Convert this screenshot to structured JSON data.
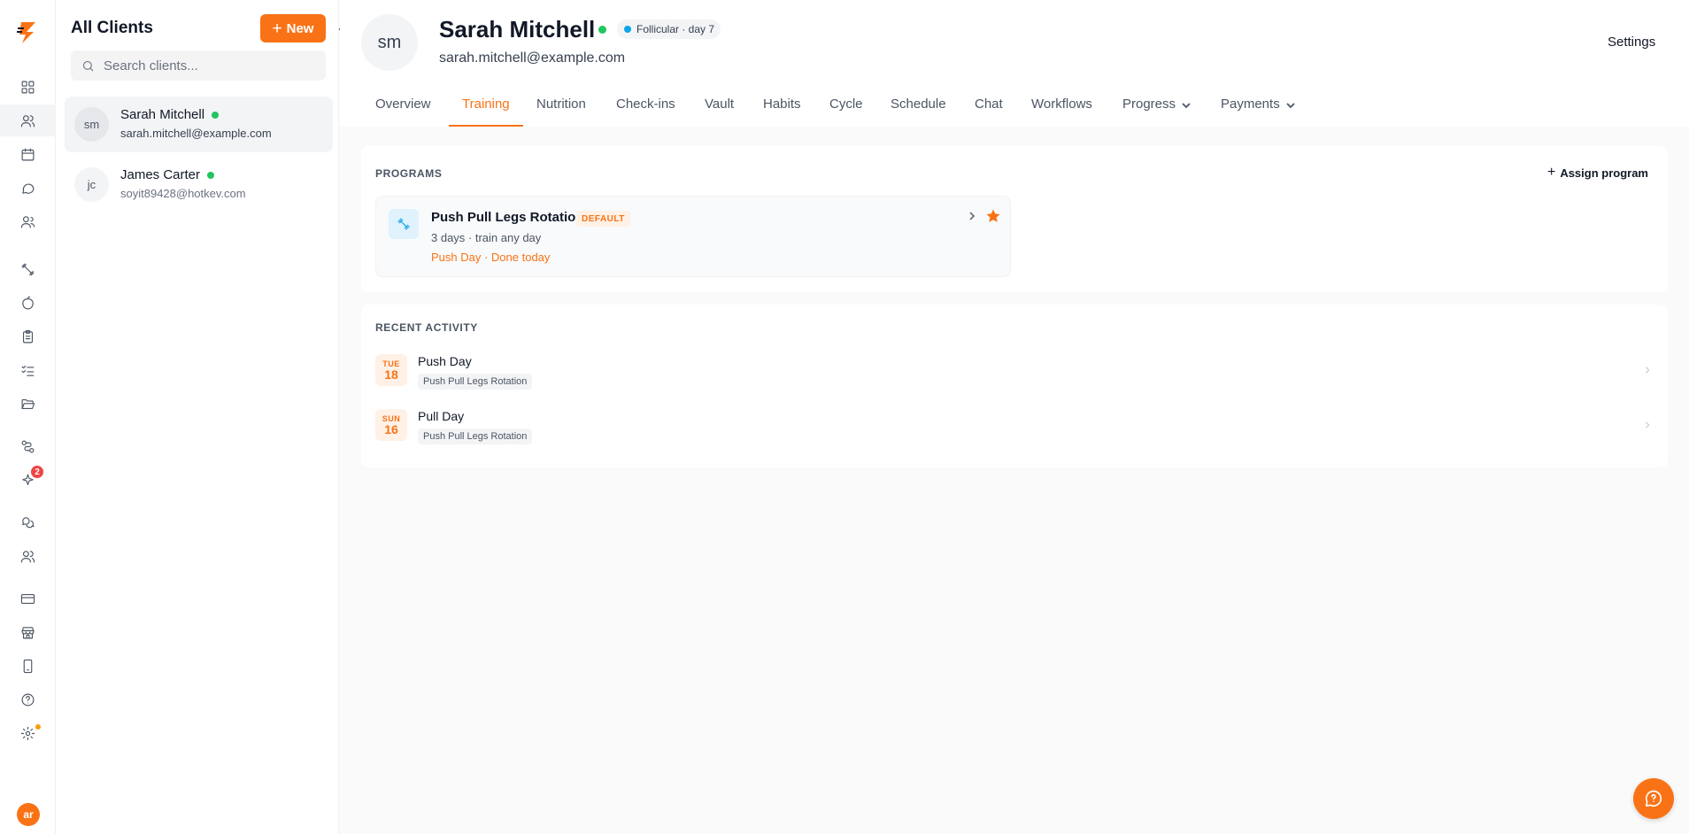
{
  "sidebar": {
    "logo_icon": "bolt-logo-icon",
    "brand_color": "#f97316",
    "items": [
      {
        "icon": "dashboard-icon"
      },
      {
        "icon": "clients-icon",
        "active": true
      },
      {
        "icon": "calendar-icon"
      },
      {
        "icon": "messages-icon"
      },
      {
        "icon": "team-icon"
      },
      {
        "icon": "workouts-icon"
      },
      {
        "icon": "nutrition-icon"
      },
      {
        "icon": "forms-icon"
      },
      {
        "icon": "habits-icon"
      },
      {
        "icon": "vault-icon"
      },
      {
        "icon": "automations-icon"
      },
      {
        "icon": "ai-sparkle-icon",
        "badge": "2"
      },
      {
        "icon": "community-icon"
      },
      {
        "icon": "groups-icon"
      },
      {
        "icon": "billing-icon"
      },
      {
        "icon": "store-icon"
      },
      {
        "icon": "mobile-app-icon"
      },
      {
        "icon": "help-icon"
      },
      {
        "icon": "settings-icon",
        "dot": true
      }
    ],
    "user_initials": "ar"
  },
  "clients_panel": {
    "title": "All Clients",
    "new_button": "New",
    "search_placeholder": "Search clients...",
    "clients": [
      {
        "initials": "sm",
        "name": "Sarah Mitchell",
        "email": "sarah.mitchell@example.com",
        "online": true,
        "selected": true
      },
      {
        "initials": "jc",
        "name": "James Carter",
        "email": "soyit89428@hotkev.com",
        "online": true,
        "selected": false
      }
    ]
  },
  "client_header": {
    "initials": "sm",
    "name": "Sarah Mitchell",
    "online": true,
    "cycle_status": "Follicular · day 7",
    "email": "sarah.mitchell@example.com",
    "settings_label": "Settings"
  },
  "tabs": [
    {
      "label": "Overview"
    },
    {
      "label": "Training",
      "active": true
    },
    {
      "label": "Nutrition"
    },
    {
      "label": "Check-ins"
    },
    {
      "label": "Vault"
    },
    {
      "label": "Habits"
    },
    {
      "label": "Cycle"
    },
    {
      "label": "Schedule"
    },
    {
      "label": "Chat"
    },
    {
      "label": "Workflows"
    },
    {
      "label": "Progress",
      "dropdown": true
    },
    {
      "label": "Payments",
      "dropdown": true
    }
  ],
  "programs": {
    "label": "PROGRAMS",
    "assign_button": "Assign program",
    "items": [
      {
        "name": "Push Pull Legs Rotation",
        "badge": "DEFAULT",
        "meta": "3 days · train any day",
        "status": "Push Day · Done today",
        "starred": true
      }
    ]
  },
  "recent_activity": {
    "label": "RECENT ACTIVITY",
    "items": [
      {
        "dow": "TUE",
        "day": "18",
        "name": "Push Day",
        "program": "Push Pull Legs Rotation"
      },
      {
        "dow": "SUN",
        "day": "16",
        "name": "Pull Day",
        "program": "Push Pull Legs Rotation"
      }
    ]
  },
  "help_fab_icon": "chat-help-icon"
}
